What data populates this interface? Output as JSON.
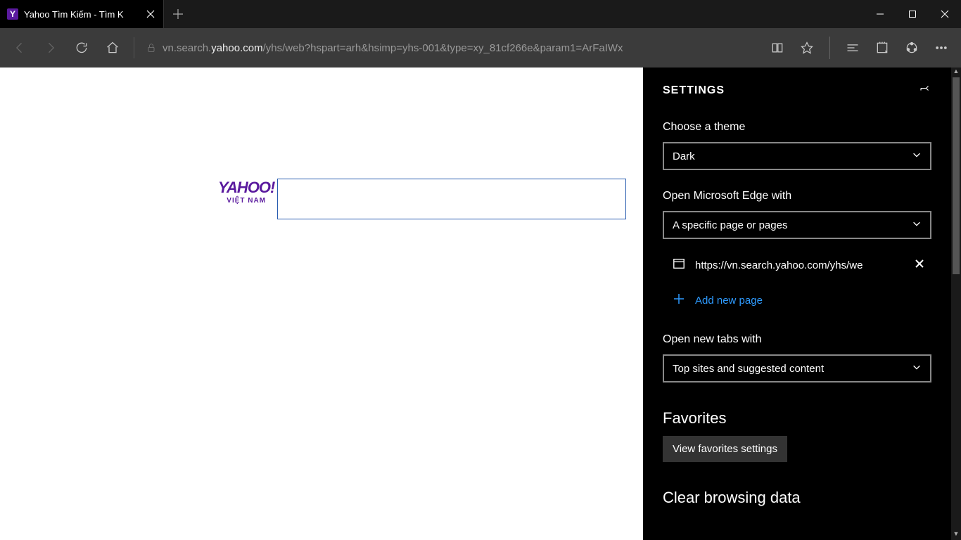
{
  "tab": {
    "favicon_letter": "Y",
    "title": "Yahoo Tìm Kiếm - Tìm K"
  },
  "address": {
    "prefix": "vn.search.",
    "domain": "yahoo.com",
    "path": "/yhs/web?hspart=arh&hsimp=yhs-001&type=xy_81cf266e&param1=ArFaIWx"
  },
  "yahoo": {
    "logo_main": "YAHOO!",
    "logo_sub": "VIỆT NAM",
    "search_value": ""
  },
  "settings": {
    "title": "SETTINGS",
    "theme_label": "Choose a theme",
    "theme_value": "Dark",
    "open_with_label": "Open Microsoft Edge with",
    "open_with_value": "A specific page or pages",
    "page_url": "https://vn.search.yahoo.com/yhs/we",
    "add_new_label": "Add new page",
    "new_tabs_label": "Open new tabs with",
    "new_tabs_value": "Top sites and suggested content",
    "favorites_heading": "Favorites",
    "favorites_btn": "View favorites settings",
    "clear_heading": "Clear browsing data"
  }
}
